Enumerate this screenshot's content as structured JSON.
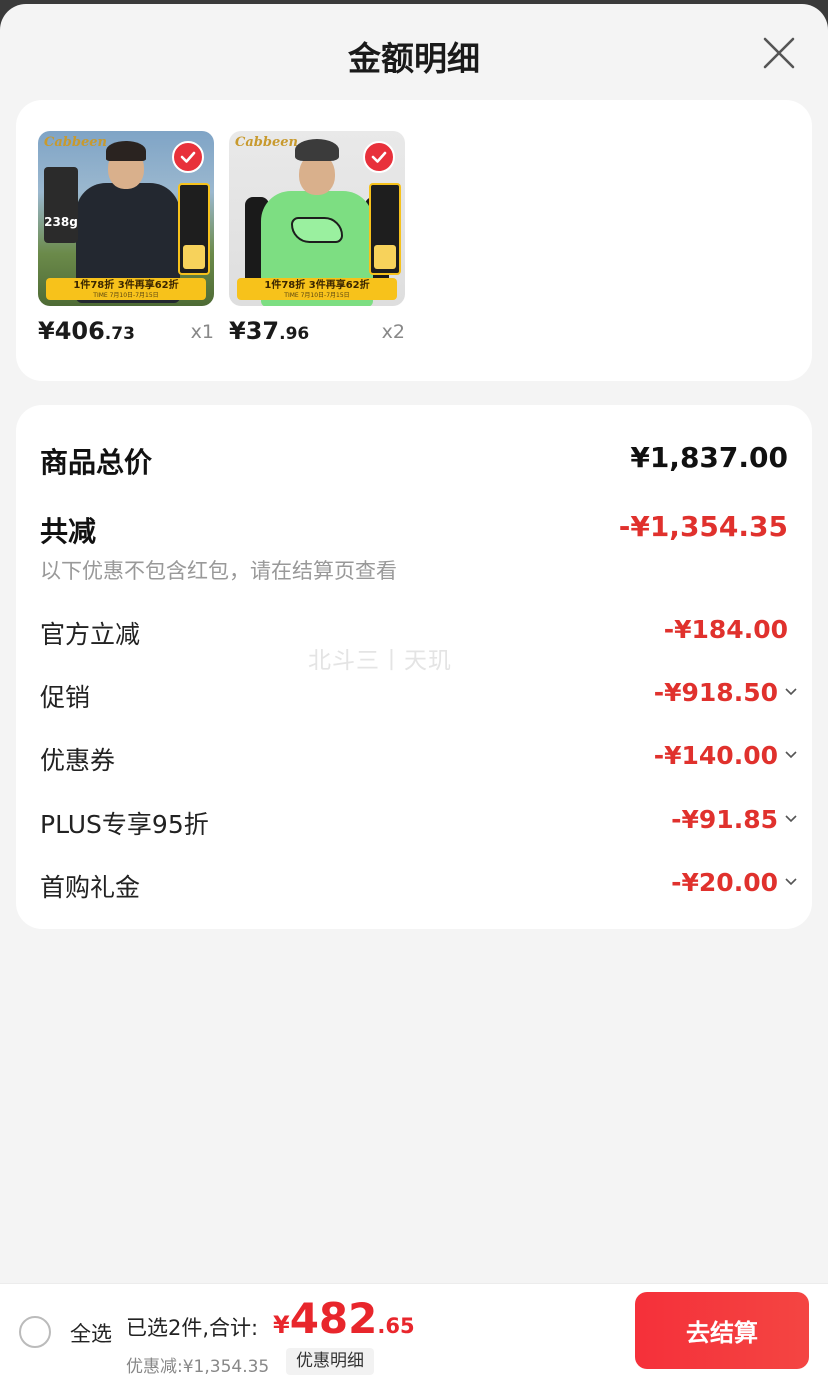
{
  "header": {
    "title": "金额明细"
  },
  "products": [
    {
      "brand": "Cabbeen",
      "image_badge": "238g",
      "promo": "1件78折 3件再享62折",
      "promo_time": "TIME 7月10日-7月15日",
      "price_int": "¥406",
      "price_cents": ".73",
      "qty": "x1",
      "checked": true
    },
    {
      "brand": "Cabbeen",
      "promo": "1件78折 3件再享62折",
      "promo_time": "TIME 7月10日-7月15日",
      "price_int": "¥37",
      "price_cents": ".96",
      "qty": "x2",
      "checked": true
    }
  ],
  "summary": {
    "total_label": "商品总价",
    "total_value": "¥1,837.00",
    "reduce_label": "共减",
    "reduce_value": "-¥1,354.35",
    "note": "以下优惠不包含红包，请在结算页查看",
    "items": [
      {
        "label": "官方立减",
        "value": "-¥184.00",
        "expandable": false
      },
      {
        "label": "促销",
        "value": "-¥918.50",
        "expandable": true
      },
      {
        "label": "优惠券",
        "value": "-¥140.00",
        "expandable": true
      },
      {
        "label": "PLUS专享95折",
        "value": "-¥91.85",
        "expandable": true
      },
      {
        "label": "首购礼金",
        "value": "-¥20.00",
        "expandable": true
      }
    ],
    "watermark": "北斗三丨天玑"
  },
  "bottom_bar": {
    "select_all": "全选",
    "selected_text": "已选2件,合计:",
    "total_yen": "¥",
    "total_int": "482",
    "total_cents": ".65",
    "discount_text": "优惠减:¥1,354.35",
    "detail_link": "优惠明细",
    "checkout": "去结算"
  },
  "colors": {
    "accent_red": "#e8262c",
    "discount_red": "#e0312d",
    "checkout_gradient": "#f5303a",
    "promo_yellow": "#f7c21b"
  }
}
